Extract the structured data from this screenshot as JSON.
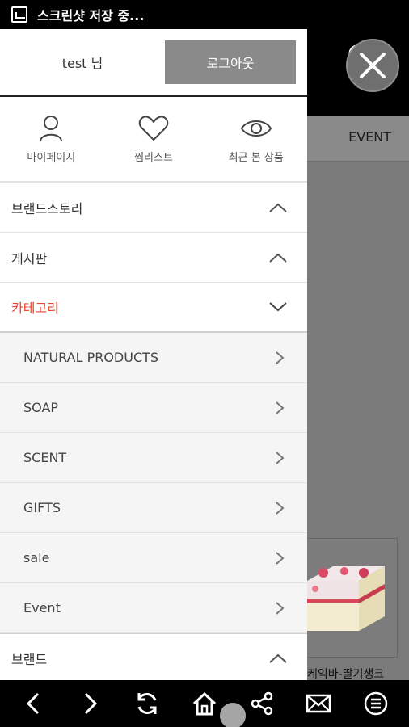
{
  "status_bar": {
    "text": "스크린샷 저장 중..."
  },
  "drawer": {
    "user_label": "test 님",
    "logout_label": "로그아웃",
    "quick_links": [
      {
        "label": "마이페이지",
        "icon": "person-icon"
      },
      {
        "label": "찜리스트",
        "icon": "heart-icon"
      },
      {
        "label": "최근 본 상품",
        "icon": "eye-icon"
      }
    ],
    "menu": [
      {
        "label": "브랜드스토리",
        "state": "collapsed"
      },
      {
        "label": "게시판",
        "state": "collapsed"
      },
      {
        "label": "카테고리",
        "state": "expanded",
        "color": "#e8462f"
      }
    ],
    "categories": [
      "NATURAL PRODUCTS",
      "SOAP",
      "SCENT",
      "GIFTS",
      "sale",
      "Event"
    ],
    "brand": {
      "label": "브랜드",
      "state": "collapsed"
    }
  },
  "background": {
    "nav_event": "EVENT",
    "product_name": "케익바-딸기생크"
  },
  "bottom_nav": [
    "back-icon",
    "forward-icon",
    "refresh-icon",
    "home-icon",
    "share-icon",
    "mail-icon",
    "menu-icon"
  ]
}
